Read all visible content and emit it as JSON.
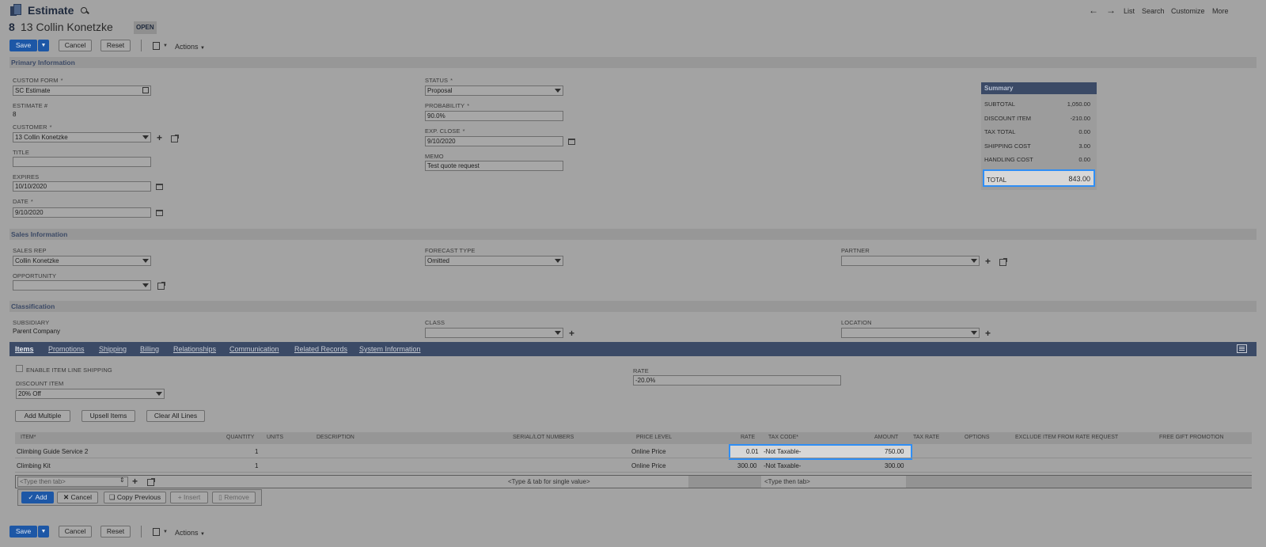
{
  "header": {
    "record_type": "Estimate",
    "record_number": "8",
    "record_name": "13 Collin Konetzke",
    "status_badge": "OPEN",
    "nav": {
      "list": "List",
      "search": "Search",
      "customize": "Customize",
      "more": "More"
    }
  },
  "toolbar": {
    "save": "Save",
    "cancel": "Cancel",
    "reset": "Reset",
    "actions": "Actions"
  },
  "sections": {
    "primary": "Primary Information",
    "sales": "Sales Information",
    "classification": "Classification"
  },
  "primary": {
    "custom_form": {
      "label": "CUSTOM FORM",
      "value": "SC Estimate"
    },
    "estimate_no": {
      "label": "ESTIMATE #",
      "value": "8"
    },
    "customer": {
      "label": "CUSTOMER",
      "value": "13 Collin Konetzke"
    },
    "title": {
      "label": "TITLE",
      "value": ""
    },
    "expires": {
      "label": "EXPIRES",
      "value": "10/10/2020"
    },
    "date": {
      "label": "DATE",
      "value": "9/10/2020"
    },
    "status": {
      "label": "STATUS",
      "value": "Proposal"
    },
    "probability": {
      "label": "PROBABILITY",
      "value": "90.0%"
    },
    "exp_close": {
      "label": "EXP. CLOSE",
      "value": "9/10/2020"
    },
    "memo": {
      "label": "MEMO",
      "value": "Test quote request"
    }
  },
  "summary": {
    "title": "Summary",
    "rows": [
      {
        "label": "SUBTOTAL",
        "value": "1,050.00"
      },
      {
        "label": "DISCOUNT ITEM",
        "value": "-210.00"
      },
      {
        "label": "TAX TOTAL",
        "value": "0.00"
      },
      {
        "label": "SHIPPING COST",
        "value": "3.00"
      },
      {
        "label": "HANDLING COST",
        "value": "0.00"
      }
    ],
    "total": {
      "label": "TOTAL",
      "value": "843.00"
    }
  },
  "sales": {
    "sales_rep": {
      "label": "SALES REP",
      "value": "Collin Konetzke"
    },
    "opportunity": {
      "label": "OPPORTUNITY",
      "value": ""
    },
    "forecast_type": {
      "label": "FORECAST TYPE",
      "value": "Omitted"
    },
    "partner": {
      "label": "PARTNER",
      "value": ""
    }
  },
  "classification": {
    "subsidiary": {
      "label": "SUBSIDIARY",
      "value": "Parent Company"
    },
    "class": {
      "label": "CLASS",
      "value": ""
    },
    "location": {
      "label": "LOCATION",
      "value": ""
    }
  },
  "tabs": [
    "Items",
    "Promotions",
    "Shipping",
    "Billing",
    "Relationships",
    "Communication",
    "Related Records",
    "System Information"
  ],
  "items": {
    "enable_line_shipping": "ENABLE ITEM LINE SHIPPING",
    "discount_item": {
      "label": "DISCOUNT ITEM",
      "value": "20% Off"
    },
    "rate": {
      "label": "RATE",
      "value": "-20.0%"
    },
    "buttons": {
      "add_multiple": "Add Multiple",
      "upsell": "Upsell Items",
      "clear": "Clear All Lines"
    },
    "columns": {
      "item": "ITEM",
      "quantity": "QUANTITY",
      "units": "UNITS",
      "description": "DESCRIPTION",
      "serial": "SERIAL/LOT NUMBERS",
      "price_level": "PRICE LEVEL",
      "rate": "RATE",
      "tax_code": "TAX CODE",
      "amount": "AMOUNT",
      "tax_rate": "TAX RATE",
      "options": "OPTIONS",
      "exclude": "EXCLUDE ITEM FROM RATE REQUEST",
      "free_gift": "FREE GIFT PROMOTION"
    },
    "rows": [
      {
        "item": "Climbing Guide Service 2",
        "quantity": "1",
        "price_level": "Online Price",
        "rate": "0.01",
        "tax_code": "-Not Taxable-",
        "amount": "750.00"
      },
      {
        "item": "Climbing Kit",
        "quantity": "1",
        "price_level": "Online Price",
        "rate": "300.00",
        "tax_code": "-Not Taxable-",
        "amount": "300.00"
      }
    ],
    "entry": {
      "item_placeholder": "<Type then tab>",
      "serial_placeholder": "<Type & tab for single value>",
      "tax_placeholder": "<Type then tab>"
    },
    "line_buttons": {
      "add": "Add",
      "cancel": "Cancel",
      "copy": "Copy Previous",
      "insert": "Insert",
      "remove": "Remove"
    }
  }
}
